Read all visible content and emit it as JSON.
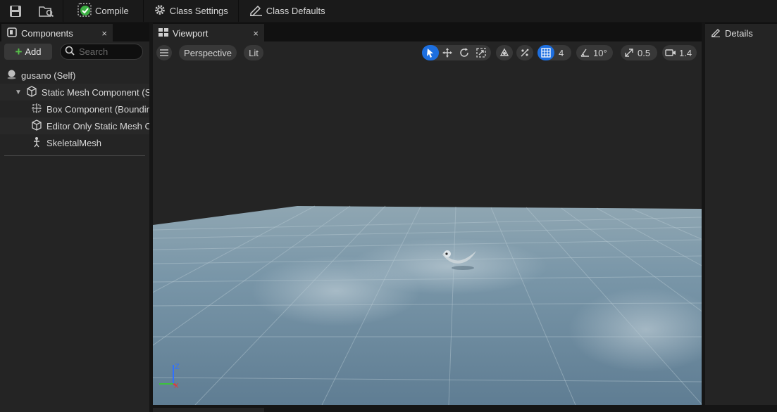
{
  "toolbar": {
    "save_icon": "save-icon",
    "browse_icon": "browse-folder-icon",
    "compile_label": "Compile",
    "class_settings_label": "Class Settings",
    "class_defaults_label": "Class Defaults"
  },
  "components": {
    "tab_label": "Components",
    "close_glyph": "×",
    "add_label": "Add",
    "search_placeholder": "Search",
    "items": [
      {
        "label": "gusano (Self)",
        "icon": "actor-sphere-icon"
      },
      {
        "label": "Static Mesh Component (S",
        "icon": "static-mesh-icon"
      },
      {
        "label": "Box Component (Boundin",
        "icon": "box-component-icon"
      },
      {
        "label": "Editor Only Static Mesh C",
        "icon": "static-mesh-icon"
      },
      {
        "label": "SkeletalMesh",
        "icon": "skeletal-mesh-icon"
      }
    ]
  },
  "viewport": {
    "tab_label": "Viewport",
    "close_glyph": "×",
    "perspective_label": "Perspective",
    "lit_label": "Lit",
    "grid_snap_value": "4",
    "rotation_snap_value": "10°",
    "scale_snap_value": "0.5",
    "camera_speed_value": "1.4",
    "axis_z": "Z",
    "axis_x": "X"
  },
  "details": {
    "tab_label": "Details"
  },
  "colors": {
    "accent": "#1d6fe0",
    "compile_ok": "#3cb043",
    "add_plus": "#57c14a"
  }
}
